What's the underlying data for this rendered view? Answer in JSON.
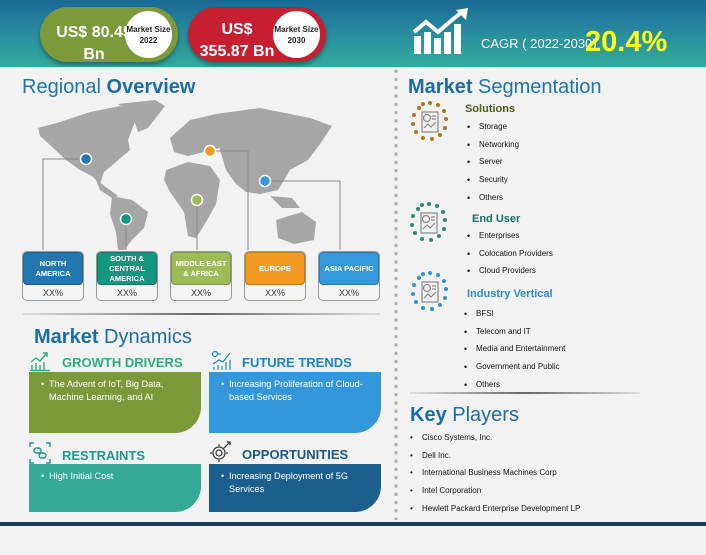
{
  "header": {
    "market_size_2022": {
      "value": "US$ 80.45 Bn",
      "label": "Market Size 2022"
    },
    "market_size_2030": {
      "value": "US$ 355.87 Bn",
      "label": "Market Size 2030"
    },
    "cagr_label": "CAGR ( 2022-2030)",
    "cagr_value": "20.4%",
    "icon": "growth-chart-icon"
  },
  "regional_overview": {
    "title_light": "Regional",
    "title_bold": "Overview",
    "regions": [
      {
        "name": "NORTH AMERICA",
        "value": "XX%",
        "color": "#2277b0"
      },
      {
        "name": "SOUTH & CENTRAL AMERICA",
        "value": "XX%",
        "color": "#14977f"
      },
      {
        "name": "MIDDLE EAST & AFRICA",
        "value": "XX%",
        "color": "#9dbb56"
      },
      {
        "name": "EUROPE",
        "value": "XX%",
        "color": "#f29a1f"
      },
      {
        "name": "ASIA PACIFIC",
        "value": "XX%",
        "color": "#3498db"
      }
    ]
  },
  "market_dynamics": {
    "title_bold": "Market",
    "title_light": "Dynamics",
    "growth_drivers": {
      "title": "GROWTH DRIVERS",
      "color": "#2ab07f",
      "card_color": "#7a9a3a",
      "items": [
        "The Advent of IoT, Big Data, Machine Learning, and AI"
      ]
    },
    "future_trends": {
      "title": "FUTURE TRENDS",
      "color": "#1a86c8",
      "card_color": "#3597db",
      "items": [
        "Increasing Proliferation of Cloud-based Services"
      ]
    },
    "restraints": {
      "title": "RESTRAINTS",
      "color": "#1b9b8a",
      "card_color": "#33a996",
      "items": [
        "High Initial Cost"
      ]
    },
    "opportunities": {
      "title": "OPPORTUNITIES",
      "color": "#17598c",
      "card_color": "#1b5f8e",
      "items": [
        "Increasing Deployment of 5G Services"
      ]
    }
  },
  "market_segmentation": {
    "title_bold": "Market",
    "title_light": "Segmentation",
    "segments": [
      {
        "title": "Solutions",
        "color": "#4d5e1f",
        "dot_color": "#b07512",
        "items": [
          "Storage",
          "Networking",
          "Server",
          "Security",
          "Others"
        ]
      },
      {
        "title": "End User",
        "color": "#1a6e5f",
        "dot_color": "#2a8a78",
        "items": [
          "Enterprises",
          "Colocation Providers",
          "Cloud Providers"
        ]
      },
      {
        "title": "Industry Vertical",
        "color": "#2b8bd0",
        "dot_color": "#2f95d6",
        "items": [
          "BFSI",
          "Telecom and IT",
          "Media and Entertainment",
          "Government and Public",
          "Others"
        ]
      }
    ]
  },
  "key_players": {
    "title_bold": "Key",
    "title_light": "Players",
    "items": [
      "Cisco Systems, Inc.",
      "Dell Inc.",
      "International Business Machines Corp",
      "Intel Corporation",
      "Hewlett Packard Enterprise Development LP"
    ]
  }
}
